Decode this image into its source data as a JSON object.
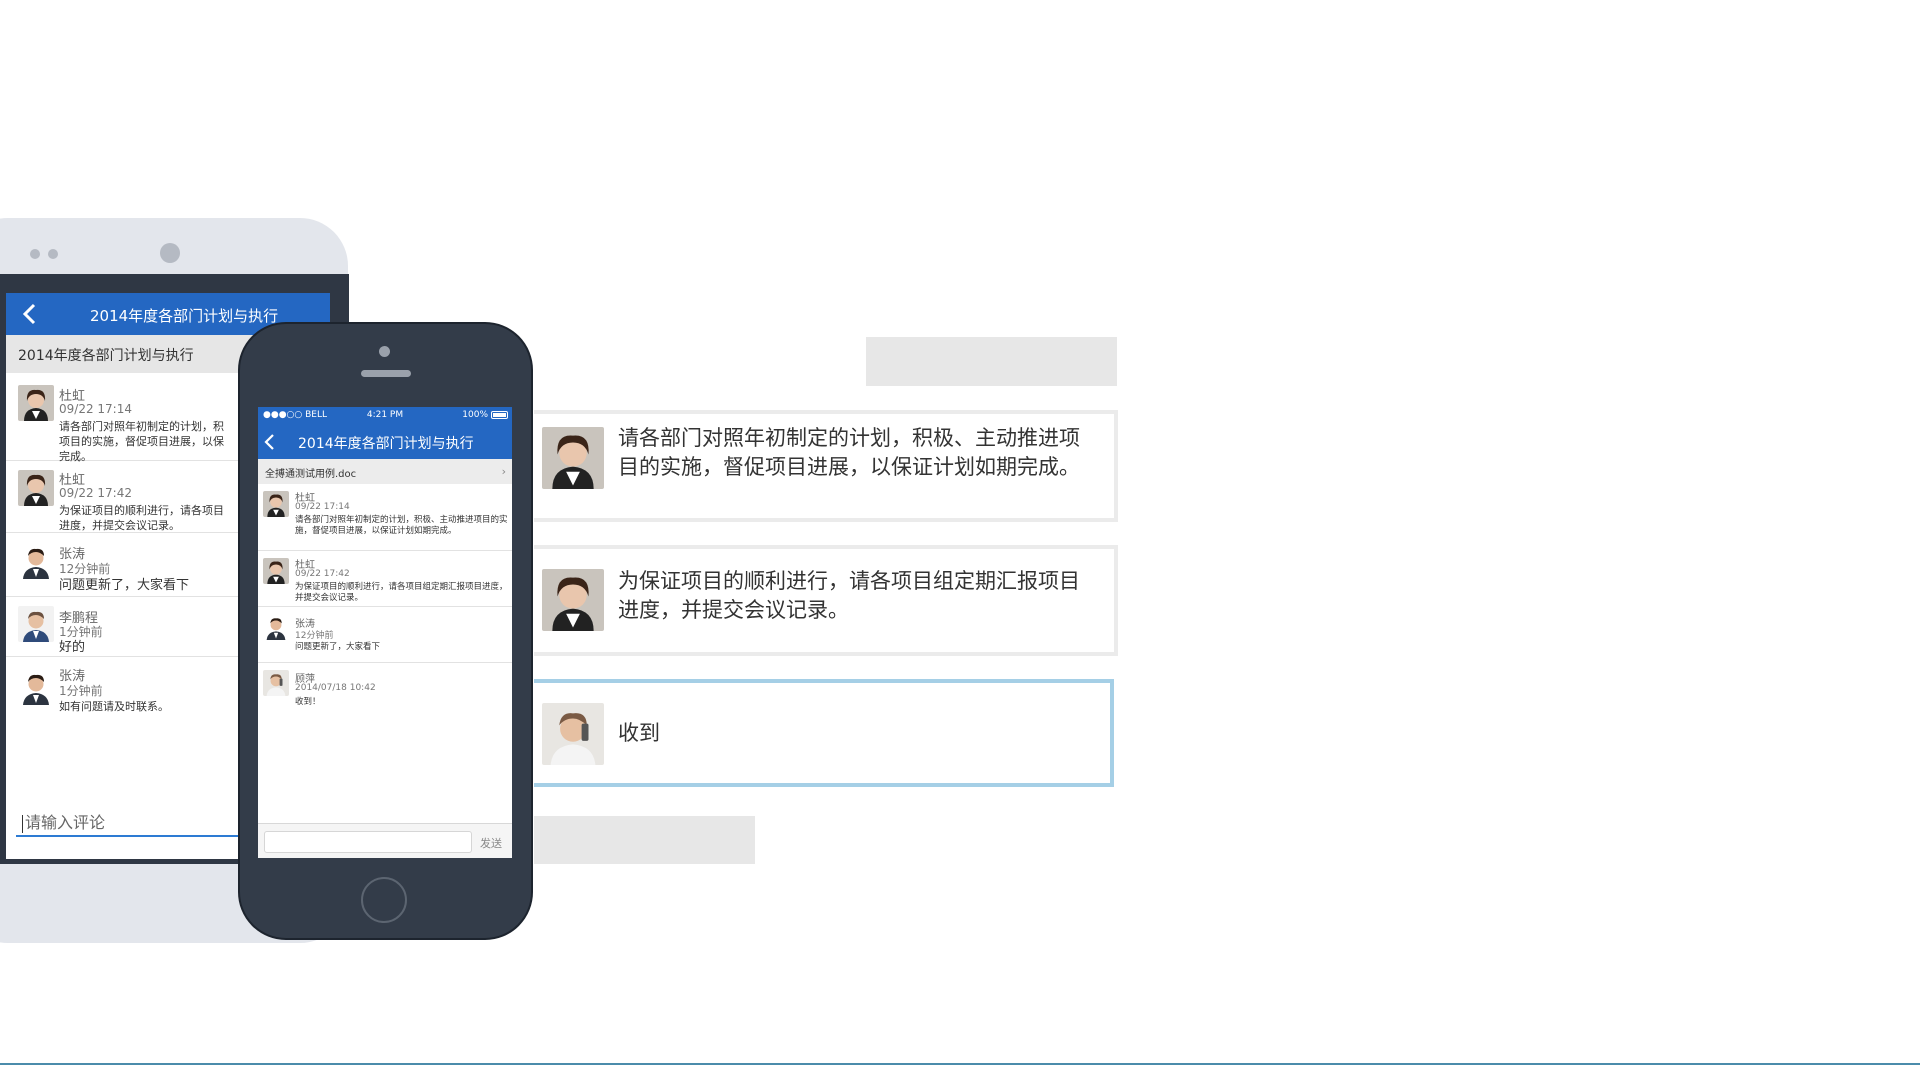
{
  "android": {
    "header_title": "2014年度各部门计划与执行",
    "sub_title": "2014年度各部门计划与执行",
    "comments": [
      {
        "name": "杜虹",
        "time": "09/22 17:14",
        "message": "请各部门对照年初制定的计划，积\n项目的实施，督促项目进展，以保\n完成。"
      },
      {
        "name": "杜虹",
        "time": "09/22 17:42",
        "message": "为保证项目的顺利进行，请各项目\n进度，并提交会议记录。"
      },
      {
        "name": "张涛",
        "time": "12分钟前",
        "message": "问题更新了，大家看下"
      },
      {
        "name": "李鹏程",
        "time": "1分钟前",
        "message": "好的"
      },
      {
        "name": "张涛",
        "time": "1分钟前",
        "message": "如有问题请及时联系。"
      }
    ],
    "input_placeholder": "请输入评论"
  },
  "iphone": {
    "status": {
      "carrier": "●●●○○ BELL",
      "time": "4:21 PM",
      "battery": "100%"
    },
    "header_title": "2014年度各部门计划与执行",
    "attachment": "全搏通测试用例.doc",
    "comments": [
      {
        "name": "杜虹",
        "time": "09/22 17:14",
        "message": "请各部门对照年初制定的计划，积极、主动推进项目的实施，督促项目进展，以保证计划如期完成。"
      },
      {
        "name": "杜虹",
        "time": "09/22 17:42",
        "message": "为保证项目的顺利进行，请各项目组定期汇报项目进度，并提交会议记录。"
      },
      {
        "name": "张涛",
        "time": "12分钟前",
        "message": "问题更新了，大家看下"
      },
      {
        "name": "顾萍",
        "time": "2014/07/18 10:42",
        "message": "收到！"
      }
    ],
    "send_label": "发送"
  },
  "cards": [
    {
      "text": "请各部门对照年初制定的计划，积极、主动推进项目的实施，督促项目进展，以保证计划如期完成。",
      "avatar": "woman-avatar"
    },
    {
      "text": "为保证项目的顺利进行，请各项目组定期汇报项目进度，并提交会议记录。",
      "avatar": "woman-avatar"
    },
    {
      "text": "收到",
      "avatar": "man-phone-avatar"
    }
  ],
  "colors": {
    "brand_blue": "#2467c2",
    "phone_dark": "#333c49",
    "selected_border": "#a5cfe6"
  }
}
